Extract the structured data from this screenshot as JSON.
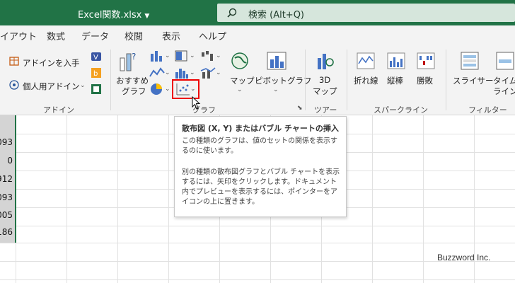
{
  "titlebar": {
    "doc_title": "Excel関数.xlsx",
    "search_label": "検索 (Alt+Q)",
    "bg_color": "#217346"
  },
  "menu": [
    "イアウト",
    "数式",
    "データ",
    "校閲",
    "表示",
    "ヘルプ"
  ],
  "ribbon": {
    "addins": {
      "get_addins": "アドインを入手",
      "my_addins": "個人用アドイン",
      "group_label": "アドイン"
    },
    "charts": {
      "recommended_line1": "おすすめ",
      "recommended_line2": "グラフ",
      "map": "マップ",
      "pivot_chart": "ピボットグラフ",
      "group_label": "グラフ"
    },
    "tours": {
      "map3d_line1": "3D",
      "map3d_line2": "マップ",
      "group_label": "ツアー"
    },
    "sparklines": {
      "line": "折れ線",
      "column": "縦棒",
      "win_loss": "勝敗",
      "group_label": "スパークライン"
    },
    "filters": {
      "slicer": "スライサー",
      "timeline": "タイム",
      "timeline_line2": "ライン",
      "group_label": "フィルター"
    }
  },
  "sheet": {
    "values": [
      "093",
      "0",
      "912",
      "093",
      "005",
      "186"
    ]
  },
  "tooltip": {
    "title": "散布図 (X, Y) またはバブル チャートの挿入",
    "desc1": "この種類のグラフは、値のセットの関係を表示するのに使います。",
    "desc2": "別の種類の散布図グラフとバブル チャートを表示するには、矢印をクリックします。ドキュメント内でプレビューを表示するには、ポインターをアイコンの上に置きます。"
  },
  "watermark": "Buzzword Inc.",
  "colors": {
    "accent": "#217346",
    "highlight": "#e00000"
  }
}
